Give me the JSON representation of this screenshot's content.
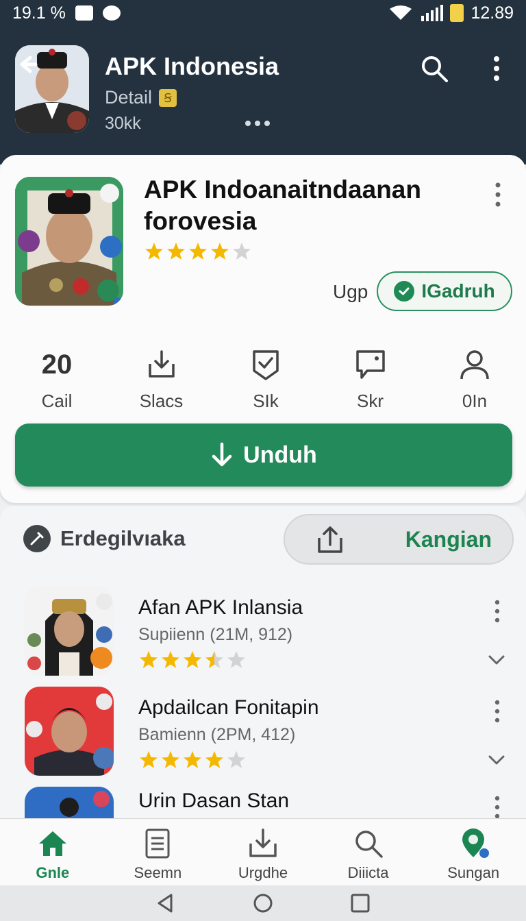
{
  "status_bar": {
    "left_text": "19.1 %",
    "time": "12.89"
  },
  "header": {
    "title": "APK Indonesia",
    "subtitle": "Detail",
    "count": "30kk",
    "badge_glyph": "Ꞩ"
  },
  "app": {
    "title": "APK Indoanaitndaanan forovesia",
    "rating": 4,
    "upgrade_label": "Ugp",
    "installed_label": "IGadruh"
  },
  "stats": [
    {
      "value": "20",
      "icon": "number",
      "label": "Cail"
    },
    {
      "icon": "download-tray-icon",
      "label": "Slacs"
    },
    {
      "icon": "shield-check-icon",
      "label": "SIk"
    },
    {
      "icon": "chat-bubble-icon",
      "label": "Skr"
    },
    {
      "icon": "person-icon",
      "label": "0In"
    }
  ],
  "download_button": {
    "label": "Unduh"
  },
  "section": {
    "title": "Erdegilvıaka",
    "share_label": "Kangian"
  },
  "list": [
    {
      "title": "Afan APK Inlansia",
      "subtitle": "Supiienn (21M, 912)",
      "rating": 3.5
    },
    {
      "title": "Apdailcan Fonitapin",
      "subtitle": "Bamienn (2PM, 412)",
      "rating": 4
    },
    {
      "title": "Urin Dasan Stan",
      "subtitle": "",
      "rating": 0
    }
  ],
  "bottom_nav": [
    {
      "label": "Gnle",
      "icon": "home-icon",
      "active": true
    },
    {
      "label": "Seemn",
      "icon": "document-icon",
      "active": false
    },
    {
      "label": "Urgdhe",
      "icon": "download-tray-icon",
      "active": false
    },
    {
      "label": "Diiicta",
      "icon": "search-icon",
      "active": false
    },
    {
      "label": "Sungan",
      "icon": "location-user-icon",
      "active": false
    }
  ],
  "colors": {
    "header_bg": "#243240",
    "accent_green": "#238a5c",
    "star": "#f5b800"
  }
}
